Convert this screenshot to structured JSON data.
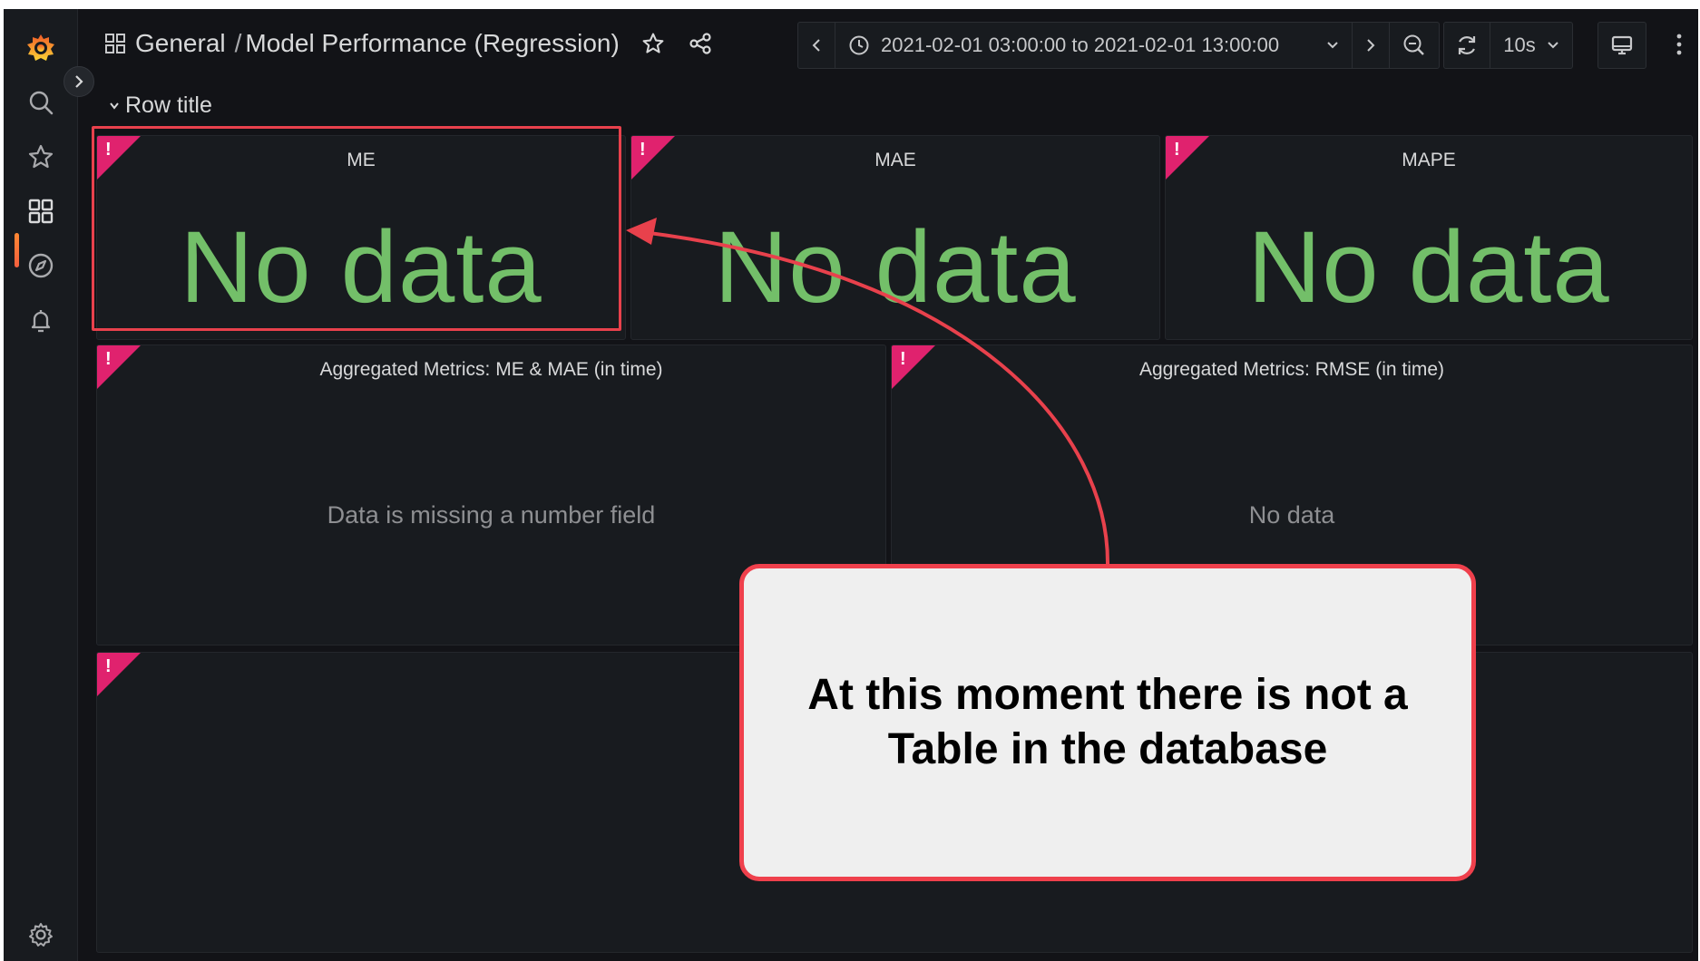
{
  "header": {
    "breadcrumb_folder": "General",
    "breadcrumb_separator": "/",
    "dashboard_title": "Model Performance (Regression)",
    "time_range": "2021-02-01 03:00:00 to 2021-02-01 13:00:00",
    "refresh_interval": "10s"
  },
  "sidebar": {
    "items": [
      {
        "icon": "grafana-logo-icon"
      },
      {
        "icon": "search-icon"
      },
      {
        "icon": "star-icon"
      },
      {
        "icon": "dashboards-icon",
        "active": true
      },
      {
        "icon": "explore-compass-icon"
      },
      {
        "icon": "alerting-bell-icon"
      },
      {
        "icon": "settings-gear-icon"
      }
    ]
  },
  "row": {
    "title": "Row title"
  },
  "panels": {
    "me": {
      "title": "ME",
      "value": "No data"
    },
    "mae": {
      "title": "MAE",
      "value": "No data"
    },
    "mape": {
      "title": "MAPE",
      "value": "No data"
    },
    "agg_me_mae": {
      "title": "Aggregated Metrics: ME & MAE (in time)",
      "message": "Data is missing a number field"
    },
    "agg_rmse": {
      "title": "Aggregated Metrics: RMSE (in time)",
      "message": "No data"
    },
    "bottom": {
      "title": ""
    }
  },
  "annotation": {
    "callout_text": "At this moment there is not a Table in the database"
  },
  "colors": {
    "background": "#121317",
    "panel": "#181b1f",
    "value_green": "#73bf69",
    "error_corner": "#e0226e",
    "annotation_red": "#e8414c",
    "accent_orange": "#ff8833"
  },
  "error_mark": "!"
}
